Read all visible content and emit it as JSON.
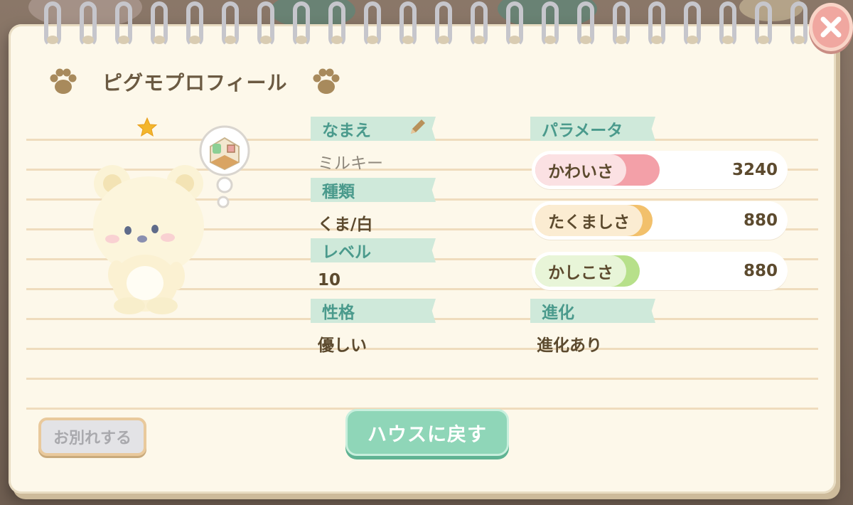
{
  "dialog": {
    "title": "ピグモプロフィール",
    "close_icon": "close-x-icon"
  },
  "profile": {
    "name_label": "なまえ",
    "name_value": "ミルキー",
    "species_label": "種類",
    "species_value": "くま/白",
    "level_label": "レベル",
    "level_value": "10",
    "personality_label": "性格",
    "personality_value": "優しい"
  },
  "parameters": {
    "label": "パラメータ",
    "items": [
      {
        "name": "かわいさ",
        "value": "3240",
        "fill": 0.5,
        "color": "#f3a0a8"
      },
      {
        "name": "たくましさ",
        "value": "880",
        "fill": 0.45,
        "color": "#f2c06b"
      },
      {
        "name": "かしこさ",
        "value": "880",
        "fill": 0.42,
        "color": "#b7e08a"
      }
    ]
  },
  "evolution": {
    "label": "進化",
    "value": "進化あり"
  },
  "buttons": {
    "farewell": "お別れする",
    "return_house": "ハウスに戻す"
  },
  "colors": {
    "accent_mint": "#8fd6b8",
    "label_text": "#4a9a8c",
    "paper": "#fdf8ea"
  }
}
